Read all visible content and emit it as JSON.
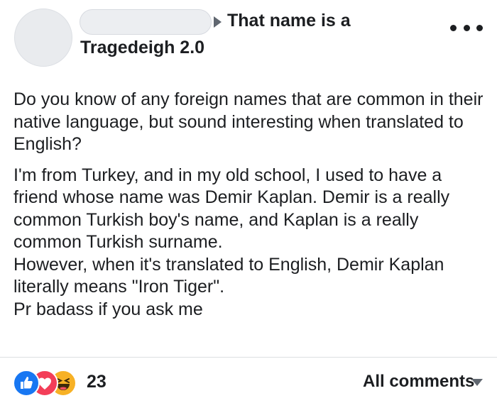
{
  "post": {
    "group_line1": "That name is a",
    "group_line2": "Tragedeigh 2.0",
    "paragraph1": "Do you know of any foreign names that are common in their native language, but sound interesting when translated to English?",
    "paragraph2_lines": [
      "I'm from Turkey, and in my old school, I used to have a friend whose name was Demir Kaplan. Demir is a really common Turkish boy's name, and Kaplan is a really common Turkish surname.",
      "However, when it's translated to English, Demir Kaplan literally means \"Iron Tiger\".",
      "Pr badass if you ask me"
    ]
  },
  "footer": {
    "reactions": [
      "like-icon",
      "love-icon",
      "haha-icon"
    ],
    "reaction_count": "23",
    "all_comments_label": "All comments"
  },
  "colors": {
    "like": "#1877f2",
    "love": "#f33e58",
    "haha": "#f7b125",
    "text": "#1c1e21",
    "muted": "#606770"
  }
}
